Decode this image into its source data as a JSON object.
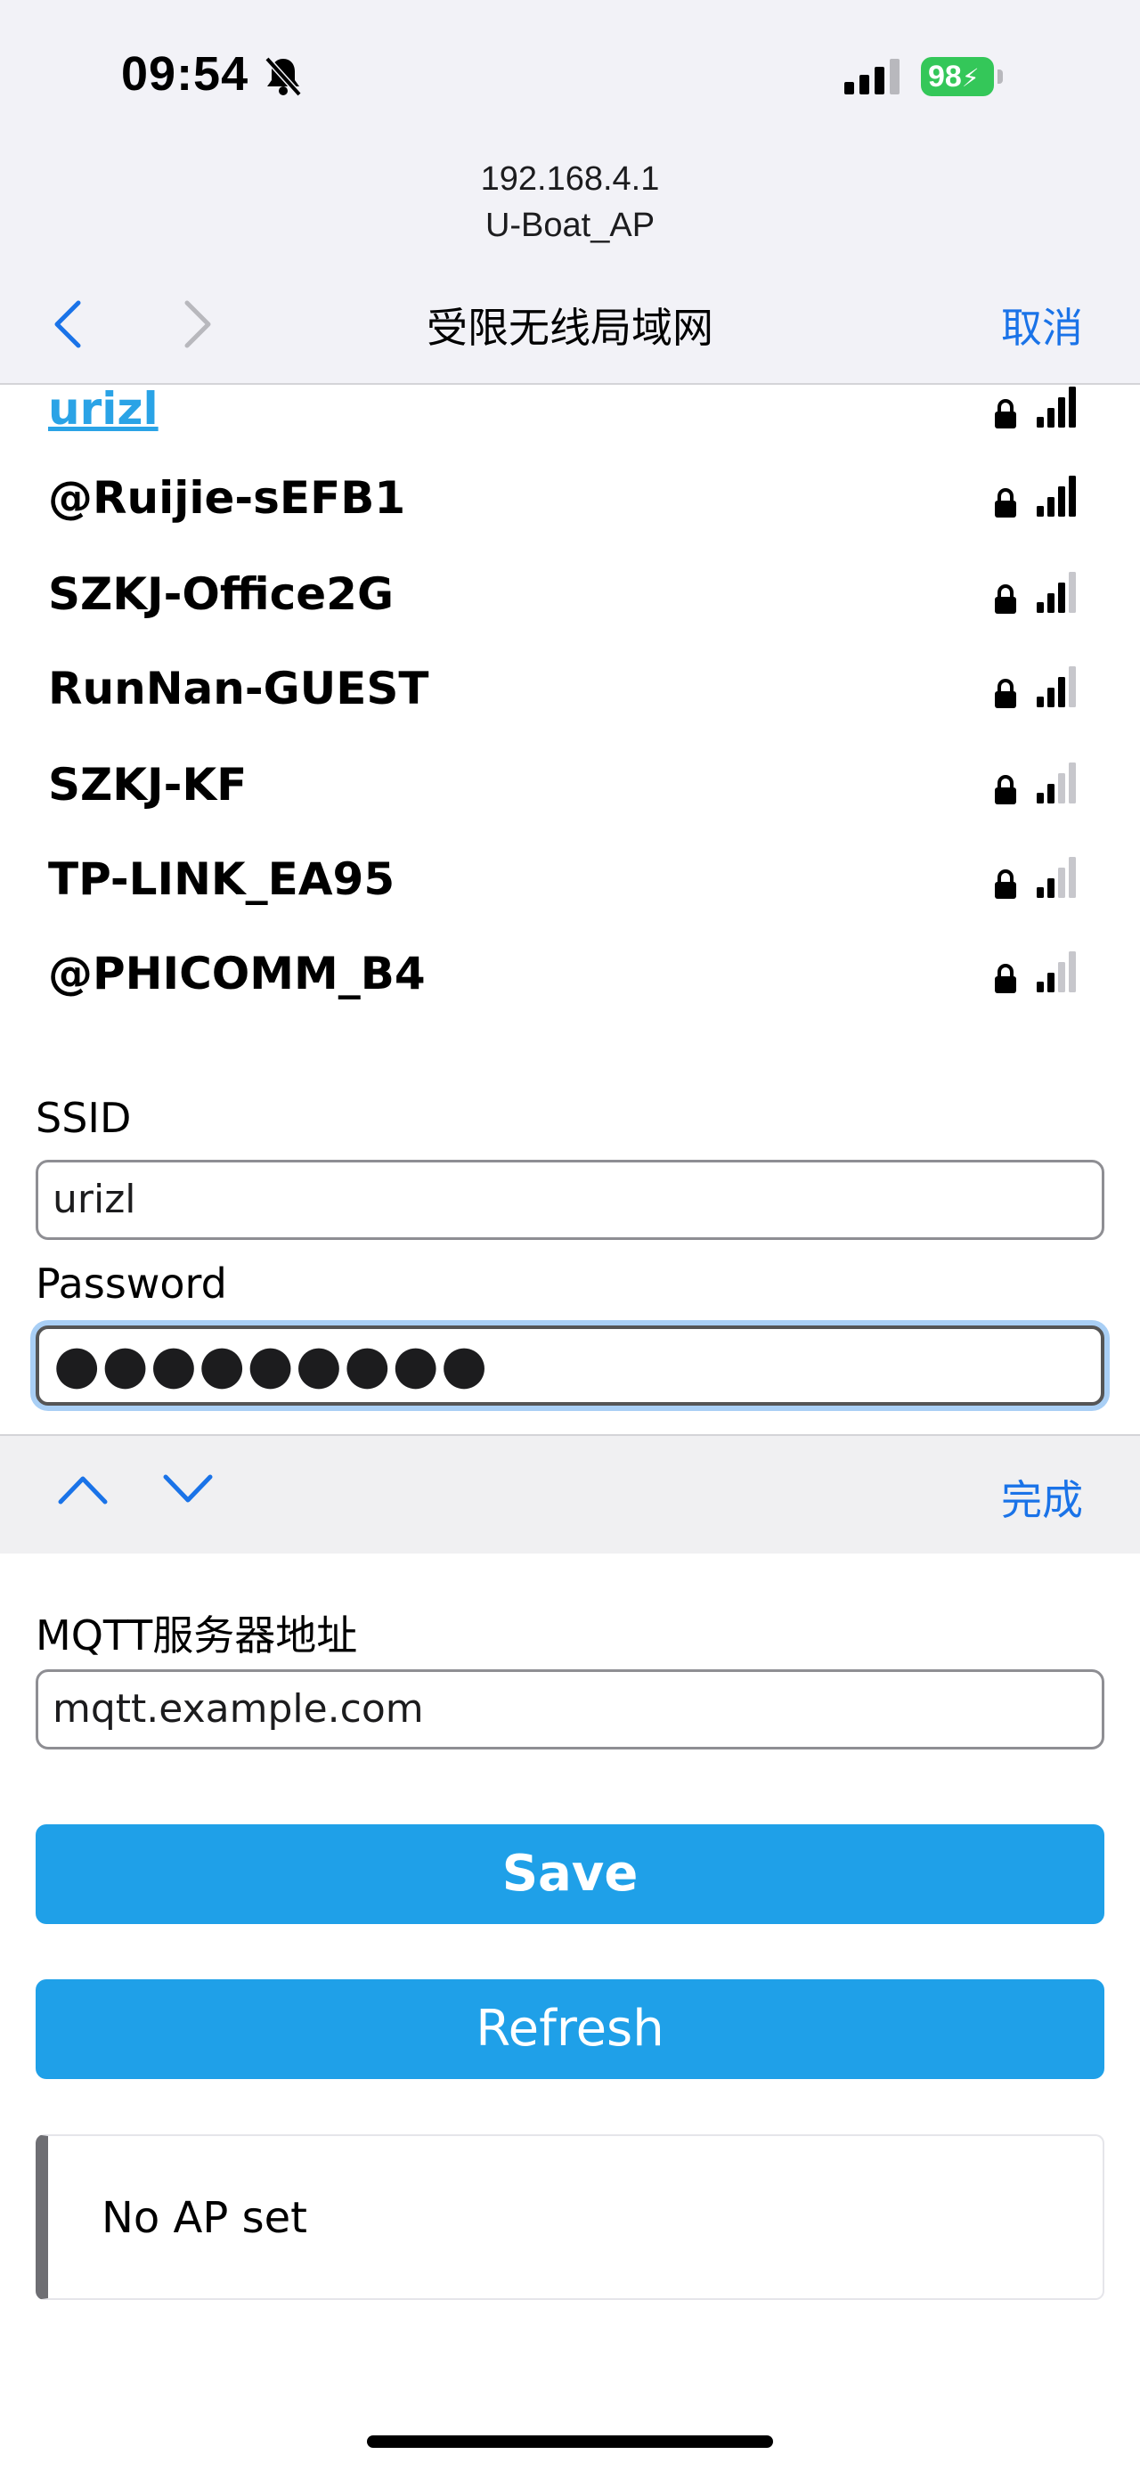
{
  "status_bar": {
    "time": "09:54",
    "battery": "98"
  },
  "browser": {
    "url_line1": "192.168.4.1",
    "url_line2": "U-Boat_AP",
    "title": "受限无线局域网",
    "cancel_label": "取消"
  },
  "wifi_networks": [
    {
      "ssid": "urizl",
      "locked": true,
      "signal_bars": 4
    },
    {
      "ssid": "@Ruijie-sEFB1",
      "locked": true,
      "signal_bars": 4
    },
    {
      "ssid": "SZKJ-Office2G",
      "locked": true,
      "signal_bars": 3
    },
    {
      "ssid": "RunNan-GUEST",
      "locked": true,
      "signal_bars": 3
    },
    {
      "ssid": "SZKJ-KF",
      "locked": true,
      "signal_bars": 2
    },
    {
      "ssid": "TP-LINK_EA95",
      "locked": true,
      "signal_bars": 2
    },
    {
      "ssid": "@PHICOMM_B4",
      "locked": true,
      "signal_bars": 2
    }
  ],
  "form": {
    "ssid_label": "SSID",
    "ssid_value": "urizl",
    "password_label": "Password",
    "password_masked": "●●●●●●●●●",
    "mqtt_label": "MQTT服务器地址",
    "mqtt_value": "mqtt.example.com"
  },
  "keyboard_accessory": {
    "done_label": "完成"
  },
  "buttons": {
    "save": "Save",
    "refresh": "Refresh"
  },
  "status_message": "No AP set",
  "colors": {
    "accent": "#1fa0e8",
    "link": "#2aa3e6",
    "ios_blue": "#1a73e8",
    "battery": "#34c759"
  }
}
